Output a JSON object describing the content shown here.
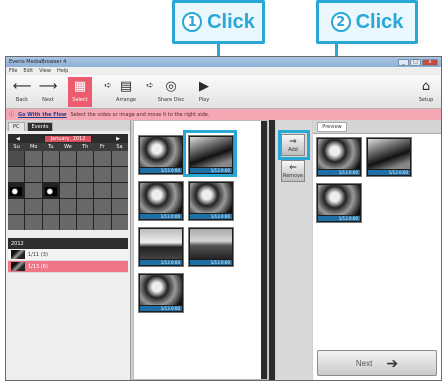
{
  "callouts": [
    {
      "num": "1",
      "label": "Click"
    },
    {
      "num": "2",
      "label": "Click"
    }
  ],
  "window": {
    "title": "Everio MediaBrowser 4",
    "controls": {
      "minimize": "_",
      "maximize": "□",
      "close": "x"
    }
  },
  "menu": [
    "File",
    "Edit",
    "View",
    "Help"
  ],
  "toolbar": {
    "back": "Back",
    "next": "Next",
    "select": "Select",
    "arrange": "Arrange",
    "share_disc": "Share Disc",
    "play": "Play",
    "settings": "Setup"
  },
  "infobar": {
    "link": "Go With the Flow",
    "text": "Select the video or image and move it to the right side."
  },
  "left_panel": {
    "tabs": [
      "PC",
      "Events"
    ],
    "month": "January, 2012",
    "prev": "◀",
    "next": "▶",
    "weekdays": [
      "Su",
      "Mo",
      "Tu",
      "We",
      "Th",
      "Fr",
      "Sa"
    ],
    "year": "2012",
    "dates": [
      {
        "label": "1/11 (3)"
      },
      {
        "label": "1/13 (6)"
      }
    ]
  },
  "center_thumbs": [
    {
      "caption": "1/13 0:00"
    },
    {
      "caption": "1/13 0:00"
    },
    {
      "caption": "1/13 0:00"
    },
    {
      "caption": "1/13 0:00"
    },
    {
      "caption": "1/13 0:00"
    },
    {
      "caption": "1/13 0:00"
    },
    {
      "caption": "1/13 0:00"
    }
  ],
  "add_buttons": [
    {
      "label": "Add"
    },
    {
      "label": "Remove"
    }
  ],
  "right_panel": {
    "tab": "Preview",
    "selected": [
      {
        "caption": "1/13 0:00"
      },
      {
        "caption": "1/13 0:00"
      },
      {
        "caption": "1/13 0:00"
      }
    ],
    "next_button": "Next"
  },
  "colors": {
    "callout": "#29a8d8",
    "accent": "#ec5b6e"
  }
}
